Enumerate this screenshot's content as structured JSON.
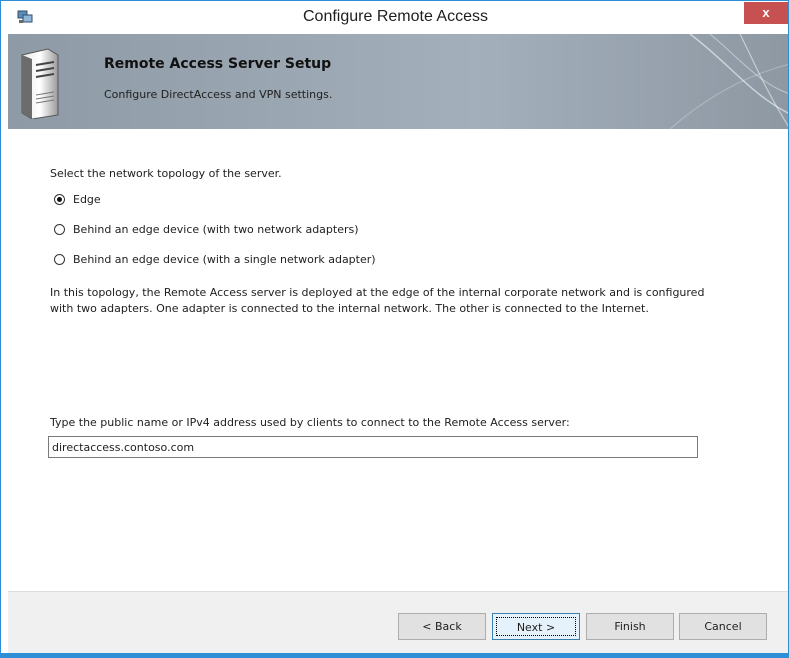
{
  "window": {
    "title": "Configure Remote Access",
    "close_label": "x"
  },
  "banner": {
    "title": "Remote Access Server Setup",
    "subtitle": "Configure DirectAccess and VPN settings."
  },
  "topology": {
    "prompt": "Select the network topology of the server.",
    "options": [
      {
        "label": "Edge",
        "selected": true
      },
      {
        "label": "Behind an edge device (with two network adapters)",
        "selected": false
      },
      {
        "label": "Behind an edge device (with a single network adapter)",
        "selected": false
      }
    ],
    "description": "In this topology, the Remote Access server is deployed at the edge of the internal corporate network and is configured with two adapters. One adapter is connected to the internal network. The other is connected to the Internet."
  },
  "address": {
    "label": "Type the public name or IPv4 address used by clients to connect to the Remote Access server:",
    "value": "directaccess.contoso.com"
  },
  "buttons": {
    "back": "< Back",
    "next": "Next >",
    "finish": "Finish",
    "cancel": "Cancel"
  },
  "colors": {
    "window_border": "#2d8fd5",
    "close_button": "#c75050",
    "banner": "#9aa6b1"
  }
}
